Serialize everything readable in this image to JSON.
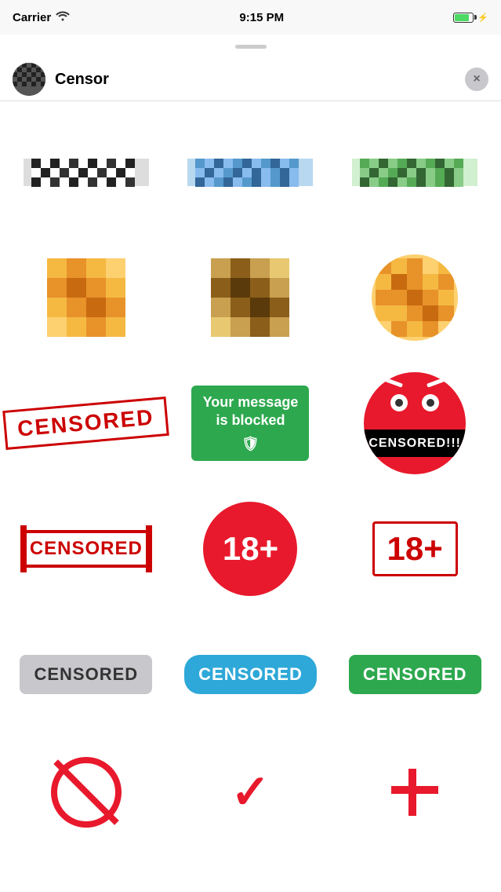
{
  "statusBar": {
    "carrier": "Carrier",
    "time": "9:15 PM",
    "wifiIcon": "wifi"
  },
  "header": {
    "title": "Censor",
    "closeLabel": "×"
  },
  "stickers": [
    {
      "id": "pixel-bw",
      "type": "pixel-bar-bw",
      "label": "Black white pixel bar"
    },
    {
      "id": "pixel-blue",
      "type": "pixel-bar-blue",
      "label": "Blue pixel bar"
    },
    {
      "id": "pixel-green",
      "type": "pixel-bar-green",
      "label": "Green pixel bar"
    },
    {
      "id": "mosaic-orange",
      "type": "mosaic-orange",
      "label": "Orange mosaic block"
    },
    {
      "id": "mosaic-brown",
      "type": "mosaic-brown",
      "label": "Brown mosaic block"
    },
    {
      "id": "mosaic-round",
      "type": "mosaic-round",
      "label": "Round orange mosaic"
    },
    {
      "id": "censored-stamp",
      "type": "censored-stamp",
      "label": "CENSORED stamp",
      "text": "CENSORED"
    },
    {
      "id": "msg-blocked",
      "type": "msg-blocked",
      "label": "Your message is blocked",
      "text": "Your message is blocked"
    },
    {
      "id": "censored-face",
      "type": "censored-face",
      "label": "Censored face",
      "text": "CENSORED!!!"
    },
    {
      "id": "censored-bars",
      "type": "censored-bars",
      "label": "CENSORED with bars",
      "text": "CENSORED"
    },
    {
      "id": "18-circle",
      "type": "18-circle",
      "label": "18+ red circle",
      "text": "18+"
    },
    {
      "id": "18-outline",
      "type": "18-outline",
      "label": "18+ outline box",
      "text": "18+"
    },
    {
      "id": "btn-gray-censored",
      "type": "btn-gray",
      "label": "Gray censored button",
      "text": "CENSORED"
    },
    {
      "id": "btn-blue-censored",
      "type": "btn-blue",
      "label": "Blue censored button",
      "text": "CENSORED"
    },
    {
      "id": "btn-green-censored",
      "type": "btn-green",
      "label": "Green censored button",
      "text": "CENSORED"
    }
  ],
  "bottomIcons": [
    {
      "id": "no-icon",
      "type": "no-sign",
      "label": "No / prohibited sign"
    },
    {
      "id": "check-icon",
      "type": "checkmark",
      "label": "Checkmark",
      "text": "✓"
    },
    {
      "id": "hash-icon",
      "type": "hashtag",
      "label": "Hash / plus sign",
      "text": "#"
    }
  ]
}
